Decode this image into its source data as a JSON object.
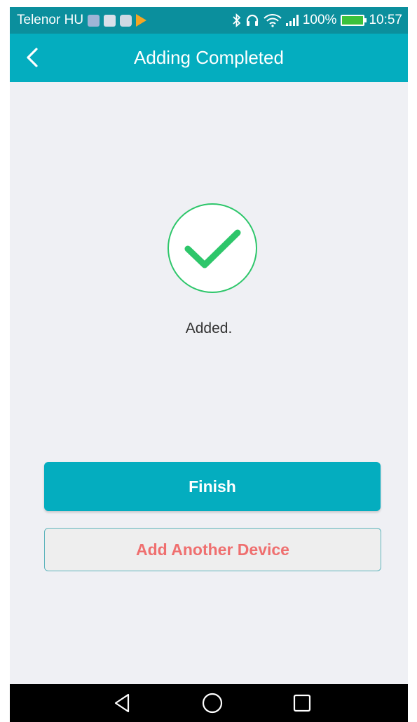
{
  "status_bar": {
    "carrier": "Telenor HU",
    "battery": "100%",
    "time": "10:57"
  },
  "header": {
    "title": "Adding Completed"
  },
  "main": {
    "message": "Added."
  },
  "buttons": {
    "finish": "Finish",
    "add_another": "Add Another Device"
  },
  "colors": {
    "primary": "#04adbf",
    "success": "#2dc66a",
    "secondary_text": "#ef6f6f",
    "background": "#eff0f4"
  }
}
